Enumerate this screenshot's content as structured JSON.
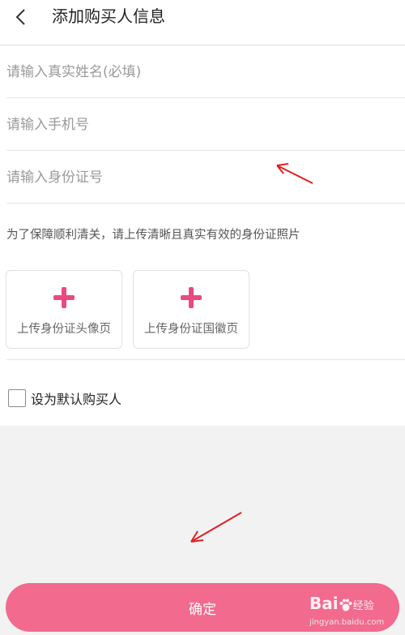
{
  "header": {
    "back_icon": "chevron-left-icon",
    "title": "添加购买人信息"
  },
  "form": {
    "name_placeholder": "请输入真实姓名(必填)",
    "phone_placeholder": "请输入手机号",
    "id_placeholder": "请输入身份证号",
    "notice": "为了保障顺利清关，请上传清晰且真实有效的身份证照片",
    "upload_front_label": "上传身份证头像页",
    "upload_back_label": "上传身份证国徽页",
    "plus_icon": "plus-icon",
    "default_buyer_label": "设为默认购买人",
    "default_checked": false
  },
  "footer": {
    "confirm_label": "确定"
  },
  "watermark": {
    "logo_prefix": "Bai",
    "logo_suffix": "经验",
    "url": "jingyan.baidu.com"
  },
  "colors": {
    "accent": "#f26a8d",
    "plus": "#ea4a7e",
    "annotation_arrow": "#e02020"
  }
}
